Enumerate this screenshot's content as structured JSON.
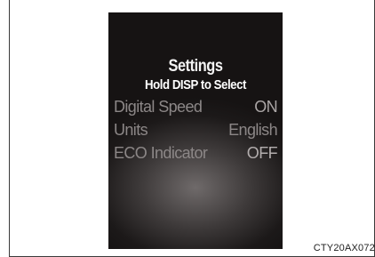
{
  "display": {
    "title": "Settings",
    "instruction": "Hold DISP to Select",
    "settings": [
      {
        "label": "Digital Speed",
        "value": "ON"
      },
      {
        "label": "Units",
        "value": "English"
      },
      {
        "label": "ECO Indicator",
        "value": "OFF"
      }
    ]
  },
  "caption": "CTY20AX072",
  "colors": {
    "screen_background": "#1c1919",
    "title_text": "#f4f4f4",
    "item_text": "#8c8787"
  }
}
